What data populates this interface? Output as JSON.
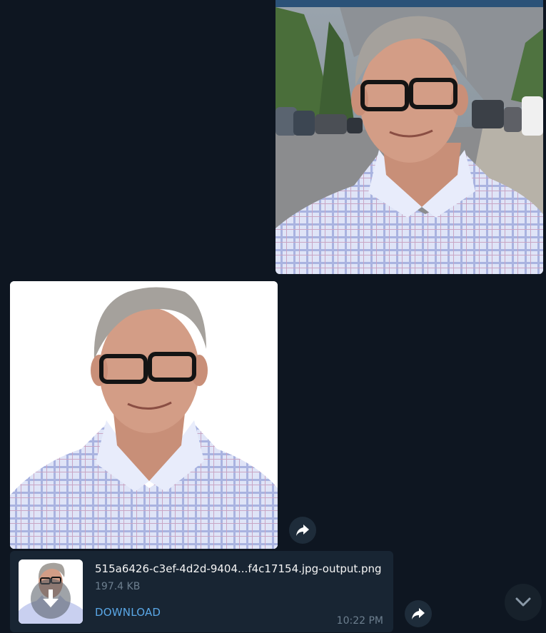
{
  "messages": {
    "sent_photo": {
      "subject": "man with glasses in checked shirt, outdoors"
    },
    "received_photo": {
      "subject": "man with glasses in checked shirt, white background"
    },
    "file": {
      "name": "515a6426-c3ef-4d2d-9404...f4c17154.jpg-output.png",
      "size": "197.4 KB",
      "action_label": "DOWNLOAD",
      "time": "10:22 PM"
    }
  },
  "icons": {
    "forward": "forward-arrow-icon",
    "download": "download-arrow-icon",
    "scroll_down": "chevron-down-icon"
  },
  "colors": {
    "background": "#0e1621",
    "bubble": "#182533",
    "link": "#5aa7e6",
    "meta_text": "#6d7f8f"
  }
}
